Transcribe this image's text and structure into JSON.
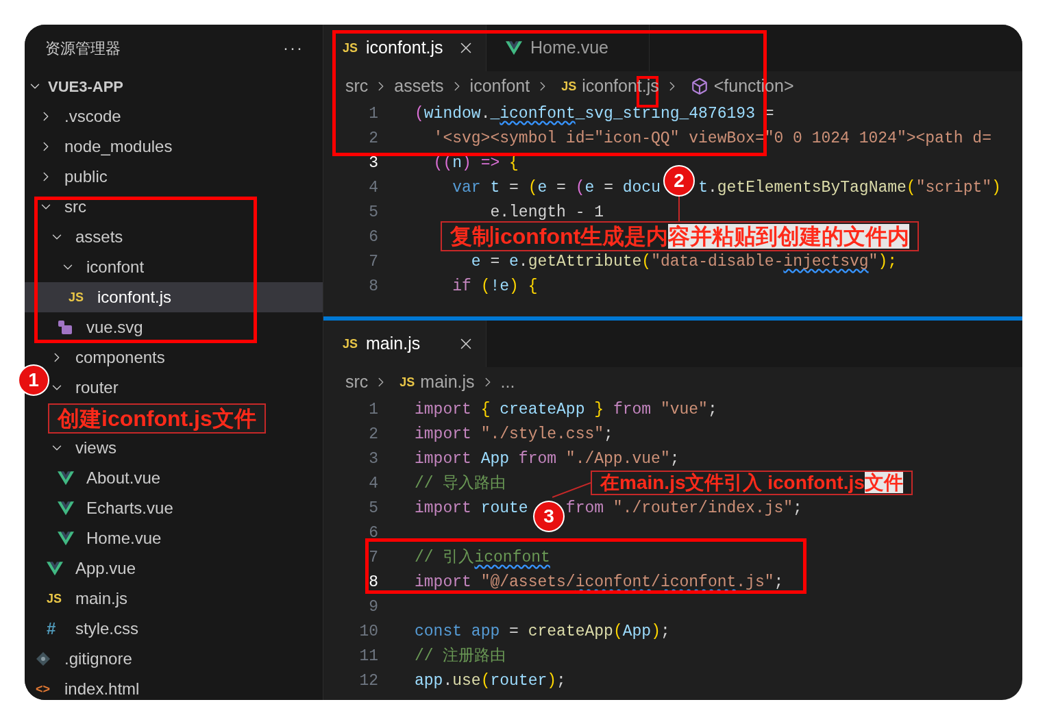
{
  "sidebar": {
    "title": "资源管理器",
    "more": "···",
    "root": {
      "label": "VUE3-APP",
      "expanded": true
    },
    "tree": [
      {
        "label": ".vscode",
        "kind": "folder",
        "expanded": false,
        "selected": false
      },
      {
        "label": "node_modules",
        "kind": "folder",
        "expanded": false,
        "selected": false
      },
      {
        "label": "public",
        "kind": "folder",
        "expanded": false,
        "selected": false
      },
      {
        "label": "src",
        "kind": "folder",
        "expanded": true,
        "selected": false,
        "children": [
          {
            "label": "assets",
            "kind": "folder",
            "expanded": true,
            "selected": false,
            "children": [
              {
                "label": "iconfont",
                "kind": "folder",
                "expanded": true,
                "selected": false,
                "children": [
                  {
                    "label": "iconfont.js",
                    "kind": "js",
                    "icon_text": "JS",
                    "selected": true
                  }
                ]
              },
              {
                "label": "vue.svg",
                "kind": "svg",
                "selected": false
              }
            ]
          },
          {
            "label": "components",
            "kind": "folder",
            "expanded": false,
            "selected": false
          },
          {
            "label": "router",
            "kind": "folder",
            "expanded": true,
            "selected": false
          },
          {
            "label": "views",
            "kind": "folder",
            "expanded": true,
            "selected": false,
            "children": [
              {
                "label": "About.vue",
                "kind": "vue",
                "selected": false
              },
              {
                "label": "Echarts.vue",
                "kind": "vue",
                "selected": false
              },
              {
                "label": "Home.vue",
                "kind": "vue",
                "selected": false
              }
            ]
          },
          {
            "label": "App.vue",
            "kind": "vue",
            "selected": false
          },
          {
            "label": "main.js",
            "kind": "js",
            "icon_text": "JS",
            "selected": false
          },
          {
            "label": "style.css",
            "kind": "css",
            "icon_text": "#",
            "selected": false
          }
        ]
      },
      {
        "label": ".gitignore",
        "kind": "git",
        "selected": false
      },
      {
        "label": "index.html",
        "kind": "html",
        "icon_text": "<>",
        "selected": false
      }
    ]
  },
  "editor_top": {
    "tabs": [
      {
        "label": "iconfont.js",
        "kind": "js",
        "icon_text": "JS",
        "selected": true,
        "closable": true
      },
      {
        "label": "Home.vue",
        "kind": "vue",
        "selected": false,
        "closable": false
      }
    ],
    "breadcrumb": [
      {
        "text": "src",
        "kind": "text"
      },
      {
        "text": "assets",
        "kind": "text"
      },
      {
        "text": "iconfont",
        "kind": "text"
      },
      {
        "text": "iconfont.js",
        "kind": "js",
        "icon_text": "JS"
      },
      {
        "text": "<function>",
        "kind": "symbol"
      }
    ],
    "lines": [
      {
        "number": "1",
        "current": false,
        "segments": [
          [
            {
              "text": "(",
              "kind": "paren2"
            },
            {
              "text": "window",
              "kind": "var"
            },
            {
              "text": ".",
              "kind": "plain"
            },
            {
              "text": "_",
              "kind": "var"
            },
            {
              "text": "iconfont",
              "kind": "var_wavy"
            },
            {
              "text": "_svg_string_4876193",
              "kind": "var"
            },
            {
              "text": " =",
              "kind": "plain"
            }
          ]
        ]
      },
      {
        "number": "2",
        "current": false,
        "segments": [
          [
            {
              "text": "  '<svg><symbol id=\"icon-QQ\" viewBox=\"0 0 1024 1024\"><path d=",
              "kind": "str"
            }
          ]
        ]
      },
      {
        "number": "3",
        "current": true,
        "segments": [
          [
            {
              "text": "  ((",
              "kind": "paren2"
            },
            {
              "text": "n",
              "kind": "var"
            },
            {
              "text": ") => ",
              "kind": "paren2"
            },
            {
              "text": "{",
              "kind": "paren"
            }
          ]
        ]
      },
      {
        "number": "4",
        "current": false,
        "segments": [
          [
            {
              "text": "    var ",
              "kind": "const"
            },
            {
              "text": "t",
              "kind": "var"
            },
            {
              "text": " = ",
              "kind": "plain"
            },
            {
              "text": "(",
              "kind": "paren"
            },
            {
              "text": "e",
              "kind": "var"
            },
            {
              "text": " = ",
              "kind": "plain"
            },
            {
              "text": "(",
              "kind": "paren2"
            },
            {
              "text": "e",
              "kind": "var"
            },
            {
              "text": " = ",
              "kind": "plain"
            },
            {
              "text": "docu",
              "kind": "var"
            }
          ],
          [
            {
              "text": "t",
              "kind": "var"
            },
            {
              "text": ".",
              "kind": "plain"
            },
            {
              "text": "getElementsByTagName",
              "kind": "fn"
            },
            {
              "text": "(",
              "kind": "paren"
            },
            {
              "text": "\"script\"",
              "kind": "str"
            },
            {
              "text": ")",
              "kind": "paren"
            }
          ]
        ]
      },
      {
        "number": "5",
        "current": false,
        "segments": [
          [
            {
              "text": "        e.length - 1",
              "kind": "plain"
            }
          ]
        ]
      },
      {
        "number": "6",
        "current": false
      },
      {
        "number": "7",
        "current": false,
        "segments": [
          [
            {
              "text": "      e",
              "kind": "var"
            },
            {
              "text": " = ",
              "kind": "plain"
            },
            {
              "text": "e",
              "kind": "var"
            },
            {
              "text": ".",
              "kind": "plain"
            },
            {
              "text": "getAttribute",
              "kind": "fn"
            },
            {
              "text": "(",
              "kind": "paren"
            },
            {
              "text": "\"data-disable-",
              "kind": "str"
            },
            {
              "text": "injectsvg",
              "kind": "str_wavy"
            },
            {
              "text": "\"",
              "kind": "str"
            },
            {
              "text": ");",
              "kind": "paren"
            }
          ]
        ]
      },
      {
        "number": "8",
        "current": false,
        "segments": [
          [
            {
              "text": "    if ",
              "kind": "kw"
            },
            {
              "text": "(",
              "kind": "paren"
            },
            {
              "text": "!e",
              "kind": "var"
            },
            {
              "text": ") ",
              "kind": "paren"
            },
            {
              "text": "{",
              "kind": "paren"
            }
          ]
        ]
      }
    ]
  },
  "editor_bottom": {
    "tabs": [
      {
        "label": "main.js",
        "kind": "js",
        "icon_text": "JS",
        "selected": true,
        "closable": true
      }
    ],
    "breadcrumb": [
      {
        "text": "src",
        "kind": "text"
      },
      {
        "text": "main.js",
        "kind": "js",
        "icon_text": "JS"
      },
      {
        "text": "...",
        "kind": "text"
      }
    ],
    "lines": [
      {
        "number": "1",
        "current": false,
        "segments": [
          [
            {
              "text": "import ",
              "kind": "kw"
            },
            {
              "text": "{ ",
              "kind": "paren"
            },
            {
              "text": "createApp",
              "kind": "var"
            },
            {
              "text": " } ",
              "kind": "paren"
            },
            {
              "text": "from ",
              "kind": "kw"
            },
            {
              "text": "\"vue\"",
              "kind": "str"
            },
            {
              "text": ";",
              "kind": "plain"
            }
          ]
        ]
      },
      {
        "number": "2",
        "current": false,
        "segments": [
          [
            {
              "text": "import ",
              "kind": "kw"
            },
            {
              "text": "\"./style.css\"",
              "kind": "str"
            },
            {
              "text": ";",
              "kind": "plain"
            }
          ]
        ]
      },
      {
        "number": "3",
        "current": false,
        "segments": [
          [
            {
              "text": "import ",
              "kind": "kw"
            },
            {
              "text": "App ",
              "kind": "var"
            },
            {
              "text": "from ",
              "kind": "kw"
            },
            {
              "text": "\"./App.vue\"",
              "kind": "str"
            },
            {
              "text": ";",
              "kind": "plain"
            }
          ]
        ]
      },
      {
        "number": "4",
        "current": false,
        "segments": [
          [
            {
              "text": "// 导入路由",
              "kind": "comment"
            }
          ]
        ]
      },
      {
        "number": "5",
        "current": false,
        "segments": [
          [
            {
              "text": "import ",
              "kind": "kw"
            },
            {
              "text": "route",
              "kind": "var"
            }
          ],
          [
            {
              "text": "from ",
              "kind": "kw"
            },
            {
              "text": "\"./router/index.js\"",
              "kind": "str"
            },
            {
              "text": ";",
              "kind": "plain"
            }
          ]
        ]
      },
      {
        "number": "6",
        "current": false
      },
      {
        "number": "7",
        "current": false,
        "segments": [
          [
            {
              "text": "// 引入",
              "kind": "comment"
            },
            {
              "text": "iconfont",
              "kind": "comment_wavy"
            }
          ]
        ]
      },
      {
        "number": "8",
        "current": true,
        "segments": [
          [
            {
              "text": "import ",
              "kind": "kw"
            },
            {
              "text": "\"@/assets/",
              "kind": "str"
            },
            {
              "text": "iconfont",
              "kind": "str_wavy"
            },
            {
              "text": "/",
              "kind": "str"
            },
            {
              "text": "iconfont",
              "kind": "str_wavy"
            },
            {
              "text": ".js\"",
              "kind": "str"
            },
            {
              "text": ";",
              "kind": "plain"
            }
          ]
        ]
      },
      {
        "number": "9",
        "current": false
      },
      {
        "number": "10",
        "current": false,
        "segments": [
          [
            {
              "text": "const ",
              "kind": "const"
            },
            {
              "text": "app",
              "kind": "const"
            },
            {
              "text": " = ",
              "kind": "plain"
            },
            {
              "text": "createApp",
              "kind": "fn"
            },
            {
              "text": "(",
              "kind": "paren"
            },
            {
              "text": "App",
              "kind": "var"
            },
            {
              "text": ")",
              "kind": "paren"
            },
            {
              "text": ";",
              "kind": "plain"
            }
          ]
        ]
      },
      {
        "number": "11",
        "current": false,
        "segments": [
          [
            {
              "text": "// 注册路由",
              "kind": "comment"
            }
          ]
        ]
      },
      {
        "number": "12",
        "current": false,
        "segments": [
          [
            {
              "text": "app",
              "kind": "var"
            },
            {
              "text": ".",
              "kind": "plain"
            },
            {
              "text": "use",
              "kind": "fn"
            },
            {
              "text": "(",
              "kind": "paren"
            },
            {
              "text": "router",
              "kind": "var"
            },
            {
              "text": ")",
              "kind": "paren"
            },
            {
              "text": ";",
              "kind": "plain"
            }
          ]
        ]
      }
    ]
  },
  "annotations": {
    "badges": [
      "1",
      "2",
      "3"
    ],
    "callouts": [
      {
        "text": "创建iconfont.js文件"
      },
      {
        "text": "复制iconfont生成是内",
        "highlight": "容并粘贴到创建的文件内"
      },
      {
        "text": "在main.js文件引入 iconfont.js",
        "highlight": "文件"
      }
    ]
  }
}
